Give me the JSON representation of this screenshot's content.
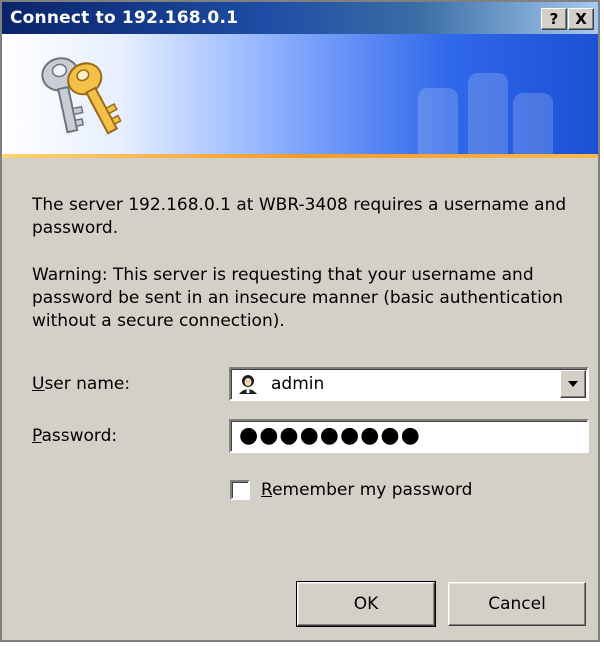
{
  "window": {
    "title": "Connect to 192.168.0.1",
    "help_button": "?",
    "close_button": "X"
  },
  "banner": {
    "icon": "keys-icon",
    "watermark_icon": "keys-watermark-icon",
    "colors": {
      "gradient_start": "#ffffff",
      "gradient_end": "#1b50d6",
      "accent_line": "#f39a26"
    }
  },
  "message": {
    "line1": "The server 192.168.0.1 at WBR-3408 requires a username and password.",
    "warning": "Warning: This server is requesting that your username and password be sent in an insecure manner (basic authentication without a secure connection)."
  },
  "form": {
    "username_label_prefix": "U",
    "username_label_rest": "ser name:",
    "username_value": "admin",
    "username_icon": "user-icon",
    "password_label_prefix": "P",
    "password_label_rest": "assword:",
    "password_masked": "●●●●●●●●●",
    "remember_label_prefix": "R",
    "remember_label_rest": "emember my password",
    "remember_checked": false
  },
  "buttons": {
    "ok": "OK",
    "cancel": "Cancel"
  }
}
